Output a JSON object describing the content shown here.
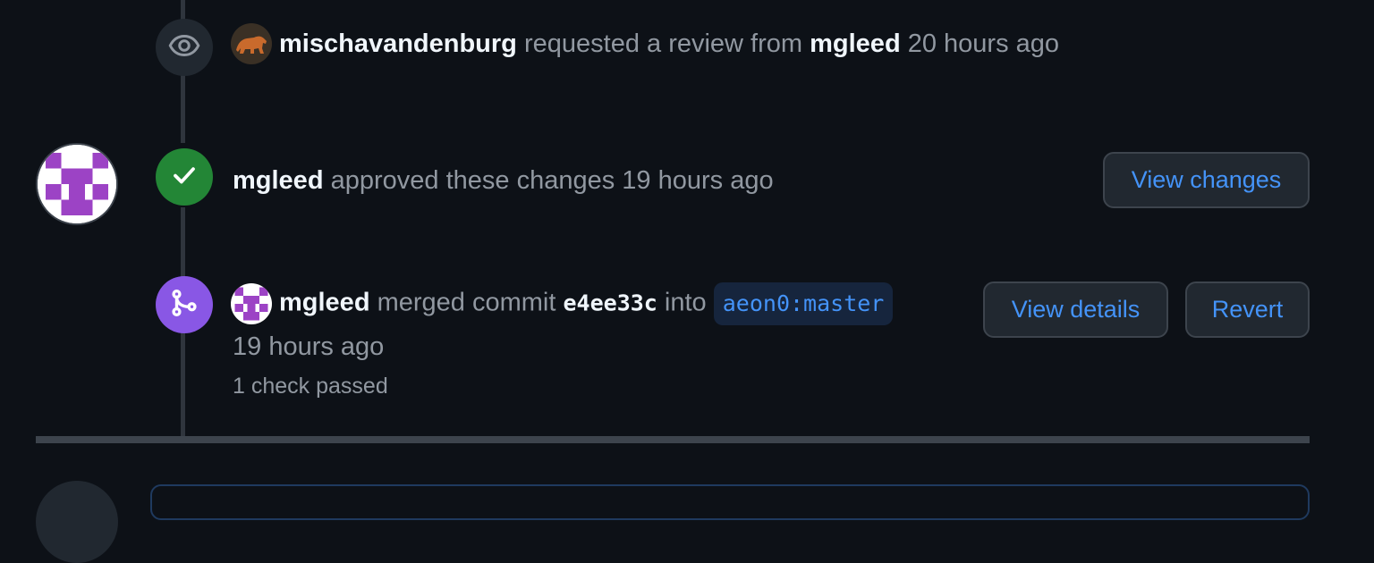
{
  "events": {
    "review_request": {
      "actor": "mischavandenburg",
      "action": "requested a review from",
      "target": "mgleed",
      "time": "20 hours ago",
      "icon": "eye-icon"
    },
    "approval": {
      "actor": "mgleed",
      "action": "approved these changes",
      "time": "19 hours ago",
      "button_label": "View changes",
      "icon": "check-icon"
    },
    "merge": {
      "actor": "mgleed",
      "action": "merged commit",
      "commit_sha": "e4ee33c",
      "into_word": "into",
      "branch": "aeon0:master",
      "time": "19 hours ago",
      "checks": "1 check passed",
      "details_label": "View details",
      "revert_label": "Revert",
      "icon": "git-merge-icon"
    }
  },
  "colors": {
    "background": "#0d1117",
    "approve": "#238636",
    "merge": "#8957e5",
    "link": "#4493f8",
    "avatar_identicon": "#9c43c5"
  }
}
